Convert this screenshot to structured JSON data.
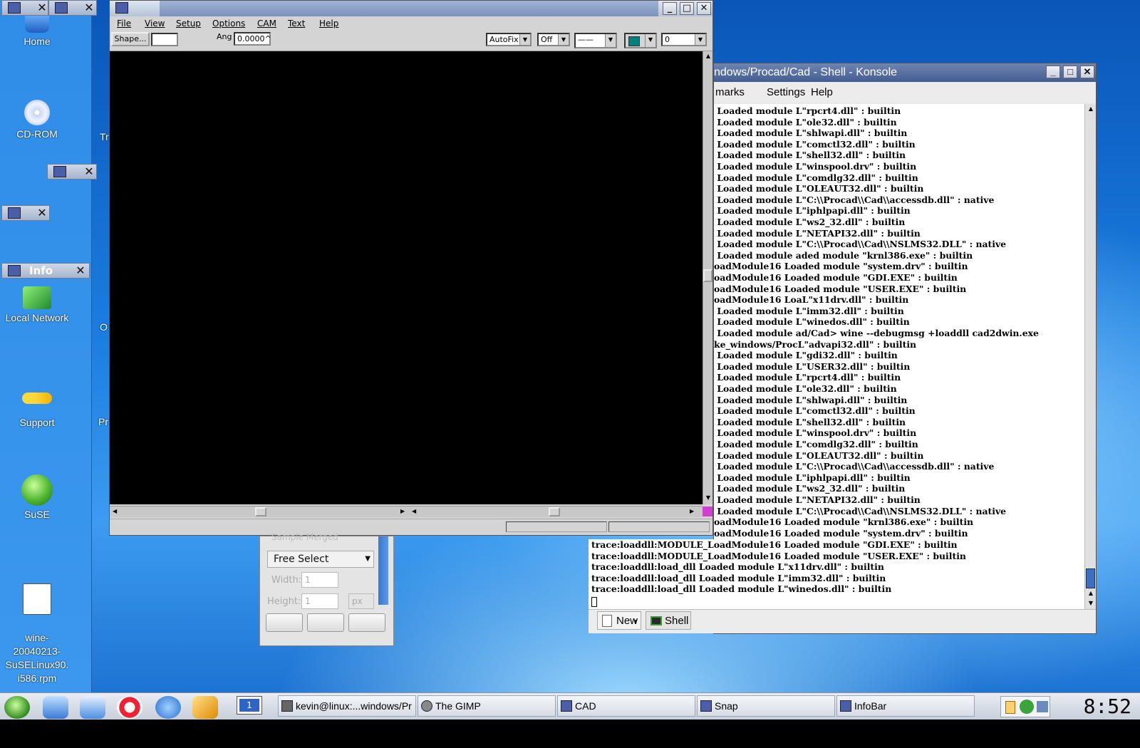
{
  "desktop": {
    "icons": [
      {
        "label": "Home",
        "icon": "home-icon"
      },
      {
        "label": "CD-ROM",
        "icon": "cdrom-icon"
      },
      {
        "label": "Local Network",
        "icon": "network-icon"
      },
      {
        "label": "Support",
        "icon": "key-icon"
      },
      {
        "label": "SuSE",
        "icon": "suse-icon"
      },
      {
        "label": "wine-\n20040213-\nSuSELinux90.\ni586.rpm",
        "icon": "rpm-icon"
      }
    ],
    "partial_labels": [
      "Tr",
      "O",
      "Pr"
    ],
    "infobar_title": "Info"
  },
  "cad": {
    "menu": [
      "File",
      "View",
      "Setup",
      "Options",
      "CAM",
      "Text",
      "Help"
    ],
    "toolbar": {
      "shape_button": "Shape...",
      "shape_value": "",
      "ang_label": "Ang",
      "ang_value": "0.0000^",
      "snap_mode": "AutoFix",
      "ortho_mode": "Off",
      "line_style": "——",
      "color": "#008080",
      "layer": "0"
    }
  },
  "gimp": {
    "partial_option": "Sample Merged",
    "select_mode": "Free Select",
    "width_label": "Width:",
    "width_value": "1",
    "height_label": "Height:",
    "height_value": "1",
    "unit": "px"
  },
  "konsole": {
    "title": "ndows/Procad/Cad - Shell - Konsole",
    "menu": [
      "marks",
      "Settings",
      "Help"
    ],
    "lines": [
      " Loaded module L\"rpcrt4.dll\" : builtin",
      " Loaded module L\"ole32.dll\" : builtin",
      " Loaded module L\"shlwapi.dll\" : builtin",
      " Loaded module L\"comctl32.dll\" : builtin",
      " Loaded module L\"shell32.dll\" : builtin",
      " Loaded module L\"winspool.drv\" : builtin",
      " Loaded module L\"comdlg32.dll\" : builtin",
      " Loaded module L\"OLEAUT32.dll\" : builtin",
      " Loaded module L\"C:\\\\Procad\\\\Cad\\\\accessdb.dll\" : native",
      " Loaded module L\"iphlpapi.dll\" : builtin",
      " Loaded module L\"ws2_32.dll\" : builtin",
      " Loaded module L\"NETAPI32.dll\" : builtin",
      " Loaded module L\"C:\\\\Procad\\\\Cad\\\\NSLMS32.DLL\" : native",
      " Loaded module aded module \"krnl386.exe\" : builtin",
      "oadModule16 Loaded module \"system.drv\" : builtin",
      "oadModule16 Loaded module \"GDI.EXE\" : builtin",
      "oadModule16 Loaded module \"USER.EXE\" : builtin",
      "oadModule16 LoaL\"x11drv.dll\" : builtin",
      " Loaded module L\"imm32.dll\" : builtin",
      " Loaded module L\"winedos.dll\" : builtin",
      " Loaded module ad/Cad> wine --debugmsg +loaddll cad2dwin.exe",
      "ke_windows/ProcL\"advapi32.dll\" : builtin",
      " Loaded module L\"gdi32.dll\" : builtin",
      " Loaded module L\"USER32.dll\" : builtin",
      " Loaded module L\"rpcrt4.dll\" : builtin",
      " Loaded module L\"ole32.dll\" : builtin",
      " Loaded module L\"shlwapi.dll\" : builtin",
      " Loaded module L\"comctl32.dll\" : builtin",
      " Loaded module L\"shell32.dll\" : builtin",
      " Loaded module L\"winspool.drv\" : builtin",
      " Loaded module L\"comdlg32.dll\" : builtin",
      " Loaded module L\"OLEAUT32.dll\" : builtin",
      " Loaded module L\"C:\\\\Procad\\\\Cad\\\\accessdb.dll\" : native",
      " Loaded module L\"iphlpapi.dll\" : builtin",
      " Loaded module L\"ws2_32.dll\" : builtin",
      " Loaded module L\"NETAPI32.dll\" : builtin",
      " Loaded module L\"C:\\\\Procad\\\\Cad\\\\NSLMS32.DLL\" : native",
      "oadModule16 Loaded module \"krnl386.exe\" : builtin",
      "oadModule16 Loaded module \"system.drv\" : builtin"
    ],
    "wide_lines": [
      "trace:loaddll:MODULE_LoadModule16 Loaded module \"GDI.EXE\" : builtin",
      "trace:loaddll:MODULE_LoadModule16 Loaded module \"USER.EXE\" : builtin",
      "trace:loaddll:load_dll Loaded module L\"x11drv.dll\" : builtin",
      "trace:loaddll:load_dll Loaded module L\"imm32.dll\" : builtin",
      "trace:loaddll:load_dll Loaded module L\"winedos.dll\" : builtin"
    ],
    "tabs": {
      "new_label": "New",
      "shell_label": "Shell"
    }
  },
  "taskbar": {
    "desktop_number": "1",
    "tasks": [
      {
        "label": "kevin@linux:...windows/Pr"
      },
      {
        "label": "The GIMP"
      },
      {
        "label": "CAD"
      },
      {
        "label": "Snap"
      },
      {
        "label": "InfoBar"
      }
    ],
    "clock": "8:52"
  }
}
